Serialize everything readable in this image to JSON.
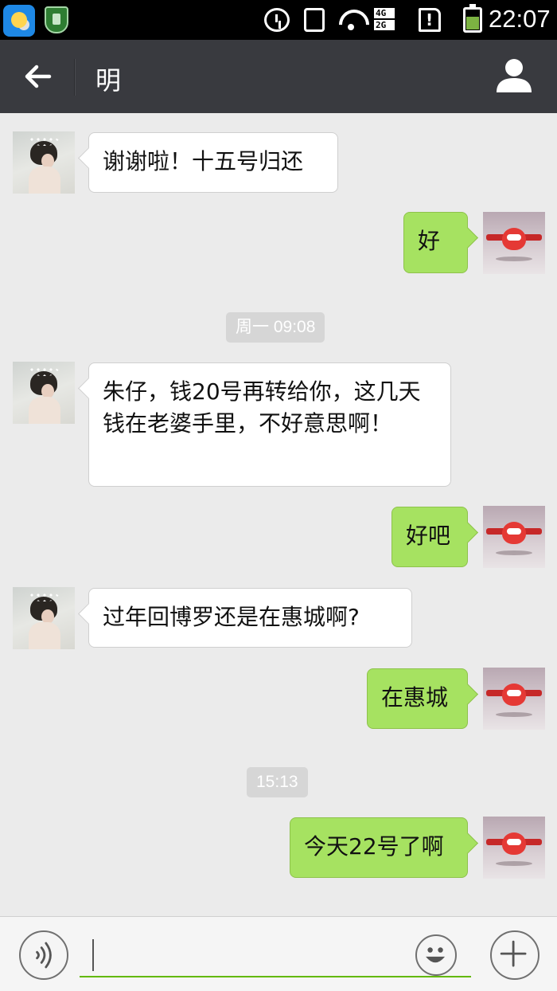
{
  "status_bar": {
    "time": "22:07",
    "network_top": "4G",
    "network_bottom": "2G",
    "icons": [
      "weather-app-icon",
      "security-app-icon",
      "alarm-icon",
      "vibrate-icon",
      "wifi-icon",
      "signal-icon",
      "sim-alert-icon",
      "battery-icon"
    ],
    "battery_level": 0.6
  },
  "header": {
    "title": "明",
    "back_icon": "arrow-left-icon",
    "contact_icon": "person-icon",
    "background": "#393a3f"
  },
  "messages": [
    {
      "side": "in",
      "text": "谢谢啦！十五号归还"
    },
    {
      "side": "out",
      "text": "好"
    },
    {
      "type": "timestamp",
      "text": "周一 09:08"
    },
    {
      "side": "in",
      "text": "朱仔，钱20号再转给你，这几天钱在老婆手里，不好意思啊！"
    },
    {
      "side": "out",
      "text": "好吧"
    },
    {
      "side": "in",
      "text": "过年回博罗还是在惠城啊?"
    },
    {
      "side": "out",
      "text": "在惠城"
    },
    {
      "type": "timestamp",
      "text": "15:13"
    },
    {
      "side": "out",
      "text": "今天22号了啊"
    }
  ],
  "input_bar": {
    "value": "",
    "voice_icon": "voice-icon",
    "emoji_icon": "emoji-icon",
    "plus_icon": "plus-icon",
    "accent": "#62b900"
  },
  "colors": {
    "bubble_out": "#a6e261",
    "bubble_in": "#ffffff",
    "chat_background": "#ebebeb"
  }
}
